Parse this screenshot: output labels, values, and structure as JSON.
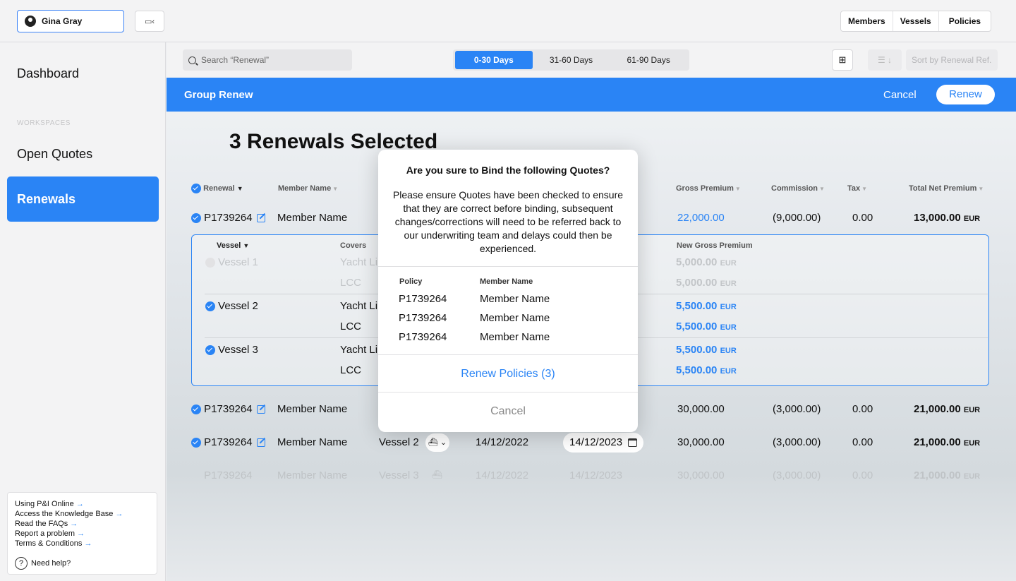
{
  "topbar": {
    "user_name": "Gina Gray",
    "nav": [
      "Members",
      "Vessels",
      "Policies"
    ]
  },
  "sidebar": {
    "dashboard": "Dashboard",
    "workspaces_label": "WORKSPACES",
    "open_quotes": "Open Quotes",
    "renewals": "Renewals",
    "help_links": [
      "Using P&I Online",
      "Access the Knowledge Base",
      "Read the FAQs",
      "Report a problem",
      "Terms & Conditions"
    ],
    "need_help": "Need help?"
  },
  "toolbar": {
    "search_placeholder": "Search “Renewal”",
    "tabs": [
      "0-30 Days",
      "31-60 Days",
      "61-90 Days"
    ],
    "sort_placeholder": "Sort by Renewal Ref."
  },
  "group_bar": {
    "title": "Group Renew",
    "cancel": "Cancel",
    "renew": "Renew"
  },
  "selection_title": "3 Renewals Selected",
  "table": {
    "headers": {
      "renewal": "Renewal",
      "member_name": "Member Name",
      "gross_premium": "Gross Premium",
      "commission": "Commission",
      "tax": "Tax",
      "total_net_premium": "Total Net Premium"
    },
    "currency": "EUR",
    "rows": [
      {
        "policy": "P1739264",
        "member": "Member Name",
        "vessel": "",
        "start": "",
        "end": "",
        "gross": "22,000.00",
        "commission": "(9,000.00)",
        "tax": "0.00",
        "total": "13,000.00"
      },
      {
        "policy": "P1739264",
        "member": "Member Name",
        "vessel": "",
        "start": "",
        "end": "",
        "gross": "30,000.00",
        "commission": "(3,000.00)",
        "tax": "0.00",
        "total": "21,000.00"
      },
      {
        "policy": "P1739264",
        "member": "Member Name",
        "vessel": "Vessel 2",
        "start": "14/12/2022",
        "end": "14/12/2023",
        "gross": "30,000.00",
        "commission": "(3,000.00)",
        "tax": "0.00",
        "total": "21,000.00"
      },
      {
        "policy": "P1739264",
        "member": "Member Name",
        "vessel": "Vessel 3",
        "start": "14/12/2022",
        "end": "14/12/2023",
        "gross": "30,000.00",
        "commission": "(3,000.00)",
        "tax": "0.00",
        "total": "21,000.00"
      }
    ],
    "expanded": {
      "headers": {
        "vessel": "Vessel",
        "covers": "Covers",
        "new_gross": "New Gross Premium"
      },
      "vessels": [
        {
          "name": "Vessel 1",
          "cover1": "Yacht Li",
          "cover2": "LCC",
          "amt1": "5,000.00",
          "amt2": "5,000.00"
        },
        {
          "name": "Vessel 2",
          "cover1": "Yacht Li",
          "cover2": "LCC",
          "amt1": "5,500.00",
          "amt2": "5,500.00"
        },
        {
          "name": "Vessel 3",
          "cover1": "Yacht Li",
          "cover2": "LCC",
          "amt1": "5,500.00",
          "amt2": "5,500.00"
        }
      ]
    }
  },
  "modal": {
    "title": "Are you sure to Bind the following Quotes?",
    "body": "Please ensure Quotes have been checked to ensure that they are correct before binding, subsequent changes/corrections will need to be referred back to our underwriting team and delays could then be experienced.",
    "col_policy": "Policy",
    "col_member": "Member Name",
    "rows": [
      {
        "policy": "P1739264",
        "member": "Member Name"
      },
      {
        "policy": "P1739264",
        "member": "Member Name"
      },
      {
        "policy": "P1739264",
        "member": "Member Name"
      }
    ],
    "confirm": "Renew Policies (3)",
    "cancel": "Cancel"
  }
}
